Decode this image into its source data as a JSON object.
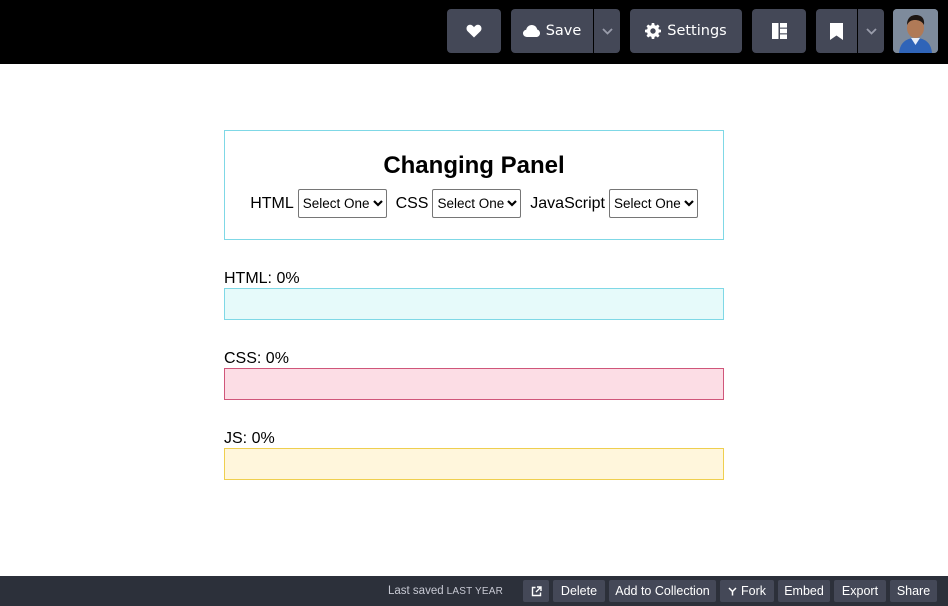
{
  "toolbar": {
    "save_label": "Save",
    "settings_label": "Settings",
    "icons": [
      "heart-icon",
      "cloud-icon",
      "chevron-down-icon",
      "gear-icon",
      "layout-icon",
      "bookmark-icon"
    ]
  },
  "panel": {
    "title": "Changing Panel",
    "selects": [
      {
        "label": "HTML",
        "value": "Select One"
      },
      {
        "label": "CSS",
        "value": "Select One"
      },
      {
        "label": "JavaScript",
        "value": "Select One"
      }
    ]
  },
  "progress": [
    {
      "label": "HTML: 0%",
      "value": 0,
      "color": "#7fd8e6"
    },
    {
      "label": "CSS: 0%",
      "value": 0,
      "color": "#d0567a"
    },
    {
      "label": "JS: 0%",
      "value": 0,
      "color": "#efcf4f"
    }
  ],
  "footer": {
    "last_saved_prefix": "Last saved",
    "last_saved_when": "LAST YEAR",
    "delete_label": "Delete",
    "collection_label": "Add to Collection",
    "fork_label": "Fork",
    "embed_label": "Embed",
    "export_label": "Export",
    "share_label": "Share"
  }
}
